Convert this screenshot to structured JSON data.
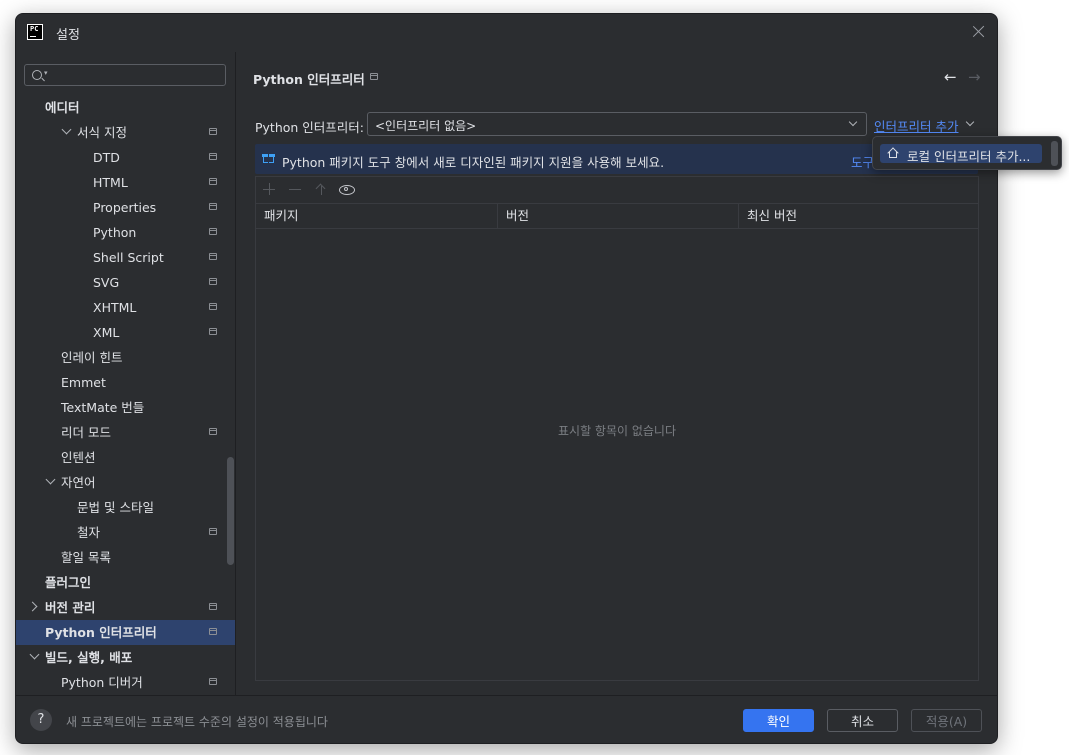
{
  "window": {
    "title": "설정"
  },
  "search": {
    "placeholder": "",
    "value": ""
  },
  "sidebar": {
    "items": [
      {
        "label": "에디터"
      },
      {
        "label": "서식 지정"
      },
      {
        "label": "DTD"
      },
      {
        "label": "HTML"
      },
      {
        "label": "Properties"
      },
      {
        "label": "Python"
      },
      {
        "label": "Shell Script"
      },
      {
        "label": "SVG"
      },
      {
        "label": "XHTML"
      },
      {
        "label": "XML"
      },
      {
        "label": "인레이 힌트"
      },
      {
        "label": "Emmet"
      },
      {
        "label": "TextMate 번들"
      },
      {
        "label": "리더 모드"
      },
      {
        "label": "인텐션"
      },
      {
        "label": "자연어"
      },
      {
        "label": "문법 및 스타일"
      },
      {
        "label": "철자"
      },
      {
        "label": "할일 목록"
      },
      {
        "label": "플러그인"
      },
      {
        "label": "버전 관리"
      },
      {
        "label": "Python 인터프리터"
      },
      {
        "label": "빌드, 실행, 배포"
      },
      {
        "label": "Python 디버거"
      }
    ]
  },
  "main": {
    "title": "Python 인터프리터",
    "interpreter_label": "Python 인터프리터:",
    "interpreter_value": "<인터프리터 없음>",
    "add_link": "인터프리터 추가",
    "banner_text": "Python 패키지 도구 창에서 새로 디자인된 패키지 지원을 사용해 보세요.",
    "banner_link": "도구",
    "table": {
      "columns": [
        "패키지",
        "버전",
        "최신 버전"
      ],
      "empty_text": "표시할 항목이 없습니다"
    }
  },
  "popup": {
    "item_label": "로컬 인터프리터 추가..."
  },
  "footer": {
    "help": "?",
    "note": "새 프로젝트에는 프로젝트 수준의 설정이 적용됩니다",
    "ok": "확인",
    "cancel": "취소",
    "apply": "적용(A)"
  },
  "colors": {
    "accent": "#3574f0",
    "selection": "#2e436e",
    "link": "#548af7",
    "background": "#2b2d30"
  }
}
